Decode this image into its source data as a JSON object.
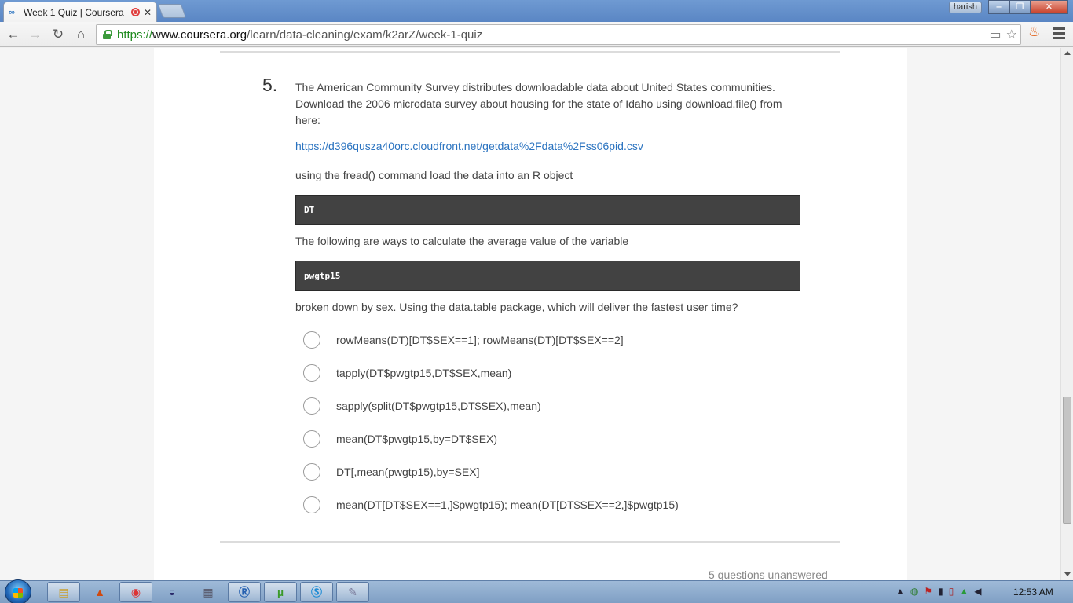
{
  "browser": {
    "tab_title": "Week 1 Quiz | Coursera",
    "tab_close": "✕",
    "user_badge": "harish",
    "url_scheme": "https://",
    "url_host": "www.coursera.org",
    "url_path": "/learn/data-cleaning/exam/k2arZ/week-1-quiz"
  },
  "question": {
    "number": "5.",
    "intro": "The American Community Survey distributes downloadable data about United States communities. Download the 2006 microdata survey about housing for the state of Idaho using download.file() from here:",
    "link": "https://d396qusza40orc.cloudfront.net/getdata%2Fdata%2Fss06pid.csv",
    "load_text": "using the fread() command load the data into an R object",
    "code_object": "DT",
    "ways_text": "The following are ways to calculate the average value of the variable",
    "code_variable": "pwgtp15",
    "prompt": "broken down by sex. Using the data.table package, which will deliver the fastest user time?",
    "options": [
      "rowMeans(DT)[DT$SEX==1]; rowMeans(DT)[DT$SEX==2]",
      "tapply(DT$pwgtp15,DT$SEX,mean)",
      "sapply(split(DT$pwgtp15,DT$SEX),mean)",
      "mean(DT$pwgtp15,by=DT$SEX)",
      "DT[,mean(pwgtp15),by=SEX]",
      "mean(DT[DT$SEX==1,]$pwgtp15); mean(DT[DT$SEX==2,]$pwgtp15)"
    ],
    "status": "5 questions unanswered"
  },
  "taskbar": {
    "clock": "12:53 AM"
  },
  "colors": {
    "link": "#2a73c0",
    "code_bg": "#424242"
  }
}
